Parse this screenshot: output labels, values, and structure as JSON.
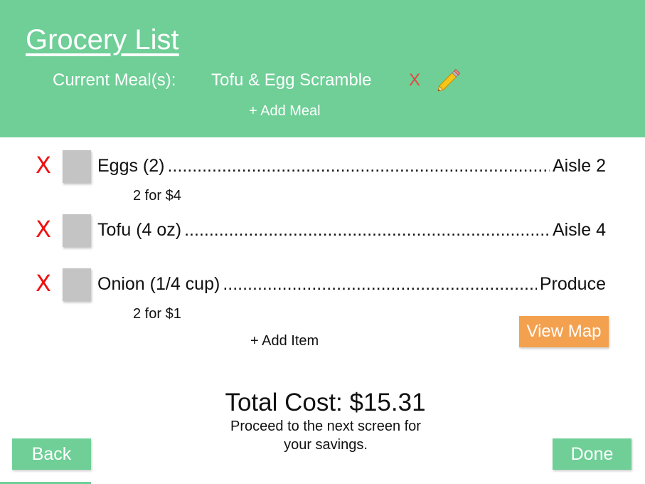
{
  "header": {
    "title": "Grocery List",
    "meal_label": "Current Meal(s):",
    "meal_name": "Tofu & Egg Scramble",
    "meal_remove": "X",
    "add_meal": "+ Add Meal"
  },
  "items": [
    {
      "remove": "X",
      "name": "Eggs (2)",
      "location": "Aisle 2",
      "deal": "2 for $4"
    },
    {
      "remove": "X",
      "name": "Tofu (4 oz)",
      "location": "Aisle 4",
      "deal": ""
    },
    {
      "remove": "X",
      "name": "Onion (1/4 cup)",
      "location": "Produce",
      "deal": "2 for $1"
    }
  ],
  "add_item": "+ Add Item",
  "view_map": "View Map",
  "total": "Total Cost: $15.31",
  "savings_note": "Proceed to the next screen for your savings.",
  "buttons": {
    "back": "Back",
    "done": "Done"
  },
  "colors": {
    "header": "#6fcf97",
    "remove": "#ee1111",
    "map_button": "#f4a14f",
    "checkbox": "#c4c4c4"
  },
  "icons": {
    "edit": "pencil-icon"
  }
}
